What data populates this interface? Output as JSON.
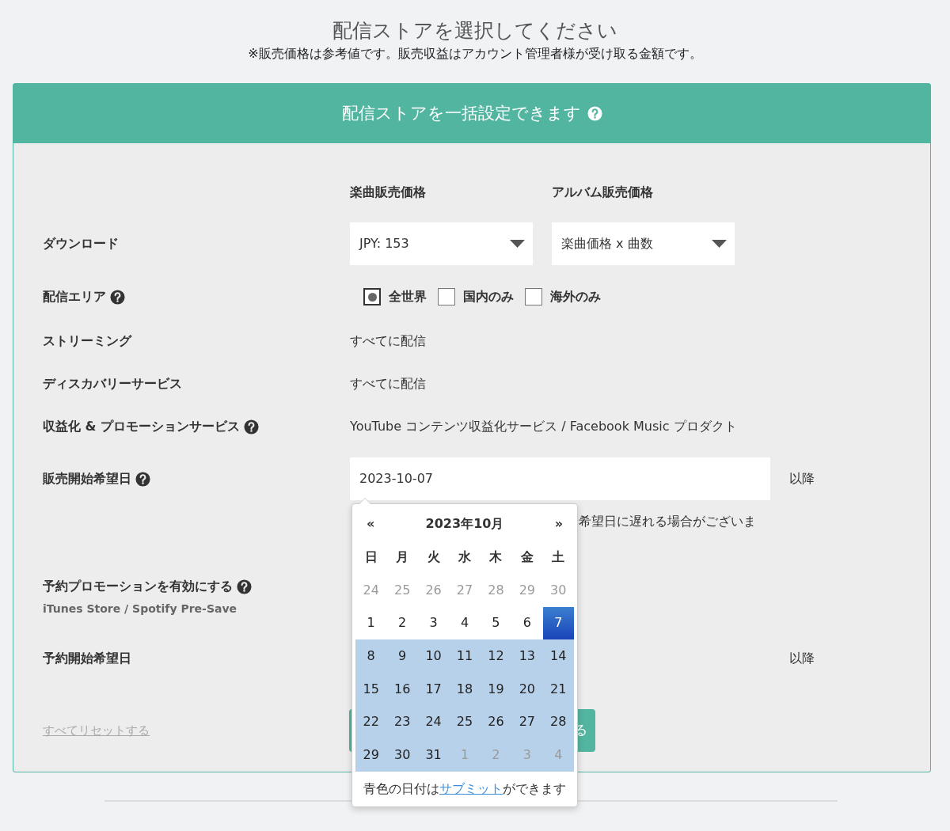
{
  "heading": "配信ストアを選択してください",
  "notice": "※販売価格は参考値です。販売収益はアカウント管理者様が受け取る金額です。",
  "card": {
    "title": "配信ストアを一括設定できます",
    "help": true
  },
  "columns": [
    "楽曲販売価格",
    "アルバム販売価格"
  ],
  "rows": [
    {
      "kind": "selects",
      "label": "ダウンロード",
      "help": false,
      "selects": [
        {
          "value": "JPY: 153"
        },
        {
          "value": "楽曲価格 x 曲数"
        }
      ]
    },
    {
      "kind": "options",
      "label": "配信エリア",
      "help": true,
      "options": [
        {
          "label": "全世界",
          "selected": true
        },
        {
          "label": "国内のみ",
          "selected": false
        },
        {
          "label": "海外のみ",
          "selected": false
        }
      ]
    },
    {
      "kind": "text",
      "label": "ストリーミング",
      "help": false,
      "value": "すべてに配信"
    },
    {
      "kind": "text",
      "label": "ディスカバリーサービス",
      "help": false,
      "value": "すべてに配信"
    },
    {
      "kind": "text",
      "label": "収益化 & プロモーションサービス",
      "help": true,
      "value": "YouTube コンテンツ収益化サービス / Facebook Music プロダクト"
    },
    {
      "kind": "date",
      "label": "販売開始希望日",
      "help": true,
      "value": "2023-10-07",
      "suffix": "以降",
      "note": "希望日に遅れる場合がございま"
    },
    {
      "kind": "toggle-label",
      "label": "予約プロモーションを有効にする",
      "help": true,
      "sublabel": "iTunes Store / Spotify Pre-Save"
    },
    {
      "kind": "suffix",
      "label": "予約開始希望日",
      "help": false,
      "suffix": "以降"
    }
  ],
  "reset_link": "すべてリセットする",
  "submit_button": "る",
  "calendar": {
    "prev": "«",
    "title": "2023年10月",
    "next": "»",
    "weekdays": [
      "日",
      "月",
      "火",
      "水",
      "木",
      "金",
      "土"
    ],
    "weeks": [
      [
        {
          "day": "24",
          "muted": true,
          "selected": false,
          "available": false
        },
        {
          "day": "25",
          "muted": true,
          "selected": false,
          "available": false
        },
        {
          "day": "26",
          "muted": true,
          "selected": false,
          "available": false
        },
        {
          "day": "27",
          "muted": true,
          "selected": false,
          "available": false
        },
        {
          "day": "28",
          "muted": true,
          "selected": false,
          "available": false
        },
        {
          "day": "29",
          "muted": true,
          "selected": false,
          "available": false
        },
        {
          "day": "30",
          "muted": true,
          "selected": false,
          "available": false
        }
      ],
      [
        {
          "day": "1",
          "muted": false,
          "selected": false,
          "available": false
        },
        {
          "day": "2",
          "muted": false,
          "selected": false,
          "available": false
        },
        {
          "day": "3",
          "muted": false,
          "selected": false,
          "available": false
        },
        {
          "day": "4",
          "muted": false,
          "selected": false,
          "available": false
        },
        {
          "day": "5",
          "muted": false,
          "selected": false,
          "available": false
        },
        {
          "day": "6",
          "muted": false,
          "selected": false,
          "available": false
        },
        {
          "day": "7",
          "muted": false,
          "selected": true,
          "available": false
        }
      ],
      [
        {
          "day": "8",
          "muted": false,
          "selected": false,
          "available": true
        },
        {
          "day": "9",
          "muted": false,
          "selected": false,
          "available": true
        },
        {
          "day": "10",
          "muted": false,
          "selected": false,
          "available": true
        },
        {
          "day": "11",
          "muted": false,
          "selected": false,
          "available": true
        },
        {
          "day": "12",
          "muted": false,
          "selected": false,
          "available": true
        },
        {
          "day": "13",
          "muted": false,
          "selected": false,
          "available": true
        },
        {
          "day": "14",
          "muted": false,
          "selected": false,
          "available": true
        }
      ],
      [
        {
          "day": "15",
          "muted": false,
          "selected": false,
          "available": true
        },
        {
          "day": "16",
          "muted": false,
          "selected": false,
          "available": true
        },
        {
          "day": "17",
          "muted": false,
          "selected": false,
          "available": true
        },
        {
          "day": "18",
          "muted": false,
          "selected": false,
          "available": true
        },
        {
          "day": "19",
          "muted": false,
          "selected": false,
          "available": true
        },
        {
          "day": "20",
          "muted": false,
          "selected": false,
          "available": true
        },
        {
          "day": "21",
          "muted": false,
          "selected": false,
          "available": true
        }
      ],
      [
        {
          "day": "22",
          "muted": false,
          "selected": false,
          "available": true
        },
        {
          "day": "23",
          "muted": false,
          "selected": false,
          "available": true
        },
        {
          "day": "24",
          "muted": false,
          "selected": false,
          "available": true
        },
        {
          "day": "25",
          "muted": false,
          "selected": false,
          "available": true
        },
        {
          "day": "26",
          "muted": false,
          "selected": false,
          "available": true
        },
        {
          "day": "27",
          "muted": false,
          "selected": false,
          "available": true
        },
        {
          "day": "28",
          "muted": false,
          "selected": false,
          "available": true
        }
      ],
      [
        {
          "day": "29",
          "muted": false,
          "selected": false,
          "available": true
        },
        {
          "day": "30",
          "muted": false,
          "selected": false,
          "available": true
        },
        {
          "day": "31",
          "muted": false,
          "selected": false,
          "available": true
        },
        {
          "day": "1",
          "muted": true,
          "selected": false,
          "available": true
        },
        {
          "day": "2",
          "muted": true,
          "selected": false,
          "available": true
        },
        {
          "day": "3",
          "muted": true,
          "selected": false,
          "available": true
        },
        {
          "day": "4",
          "muted": true,
          "selected": false,
          "available": true
        }
      ]
    ],
    "footer_before": "青色の日付は",
    "footer_link": "サブミット",
    "footer_after": "ができます"
  }
}
